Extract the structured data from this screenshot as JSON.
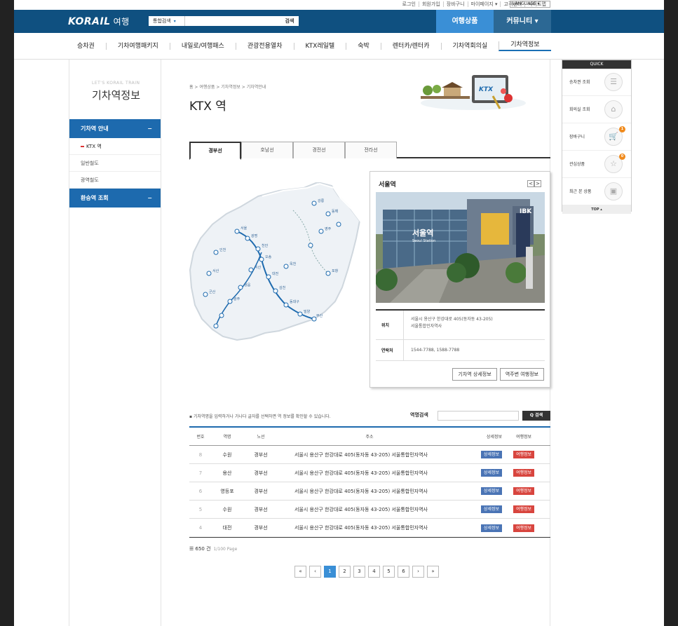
{
  "util": {
    "links": [
      "로그인",
      "회원가입",
      "장바구니",
      "마이페이지 ▾",
      "고객센터",
      "사이트맵"
    ],
    "language": "LANGUAGE"
  },
  "header": {
    "logo": "KORAIL",
    "logo_sub": "여행",
    "search_select": "통합검색",
    "search_button": "검색",
    "topnav": [
      "여행상품",
      "커뮤니티 ▾"
    ]
  },
  "gnb": [
    "승차권",
    "기차여행패키지",
    "내일로/여행패스",
    "관광전용열차",
    "KTX레일텔",
    "숙박",
    "렌터카/렌터카",
    "기차역회의실",
    "기차역정보"
  ],
  "side": {
    "brand_en": "LET'S KORAIL TRAIN",
    "brand_ko": "기차역정보",
    "menu1": "기차역 안내",
    "items": [
      "KTX 역",
      "일반철도",
      "광역철도"
    ],
    "menu2": "환승역 조회",
    "toggle": "−"
  },
  "content": {
    "breadcrumb": "홈 > 여행상품 > 기차역정보 > 기차역안내",
    "title": "KTX 역",
    "tabs": [
      "경부선",
      "호남선",
      "경전선",
      "전라선"
    ],
    "card": {
      "title": "서울역",
      "arrows": [
        "<",
        ">"
      ],
      "photo_sign": "서울역",
      "photo_sign_en": "Seoul Station",
      "location_label": "위치",
      "location": "서울시 용산구  한강대로 405(동자동 43-205)",
      "location2": "서울통합민자역사",
      "contact_label": "연락처",
      "contact": "1544-7788, 1588-7788",
      "btn_detail": "기차역 상세정보",
      "btn_travel": "역주변 여행정보"
    },
    "search_hint": "▪ 기차역명을 입력하거나 가나다 글자를 선택하면 역 정보를 확인할 수 있습니다.",
    "search_label": "역명검색",
    "search_btn": "Q 검색",
    "columns": [
      "번호",
      "역명",
      "노선",
      "주소",
      "상세정보",
      "여행정보"
    ],
    "rows": [
      {
        "no": "8",
        "name": "수원",
        "line": "경부선",
        "addr": "서울시 용산구 한강대로 405(동자동 43-205) 서울통합민자역사",
        "d": "상세정보",
        "t": "여행정보"
      },
      {
        "no": "7",
        "name": "용산",
        "line": "경부선",
        "addr": "서울시 용산구 한강대로 405(동자동 43-205) 서울통합민자역사",
        "d": "상세정보",
        "t": "여행정보"
      },
      {
        "no": "6",
        "name": "영등포",
        "line": "경부선",
        "addr": "서울시 용산구 한강대로 405(동자동 43-205) 서울통합민자역사",
        "d": "상세정보",
        "t": "여행정보"
      },
      {
        "no": "5",
        "name": "수원",
        "line": "경부선",
        "addr": "서울시 용산구 한강대로 405(동자동 43-205) 서울통합민자역사",
        "d": "상세정보",
        "t": "여행정보"
      },
      {
        "no": "4",
        "name": "대전",
        "line": "경부선",
        "addr": "서울시 용산구 한강대로 405(동자동 43-205) 서울통합민자역사",
        "d": "상세정보",
        "t": "여행정보"
      }
    ],
    "total": "650 건",
    "page_info": "1/100 Page",
    "pager": [
      "«",
      "‹",
      "1",
      "2",
      "3",
      "4",
      "5",
      "6",
      "›",
      "»"
    ]
  },
  "quick": {
    "title": "QUICK",
    "items": [
      {
        "label": "승차권 조회",
        "icon": "☰"
      },
      {
        "label": "회의실 조회",
        "icon": "⌂"
      },
      {
        "label": "장바구니",
        "icon": "🛒",
        "count": "1"
      },
      {
        "label": "관심상품",
        "icon": "☆",
        "count": "0"
      },
      {
        "label": "최근 본 상품",
        "icon": "▣"
      }
    ],
    "top": "TOP ▴"
  }
}
